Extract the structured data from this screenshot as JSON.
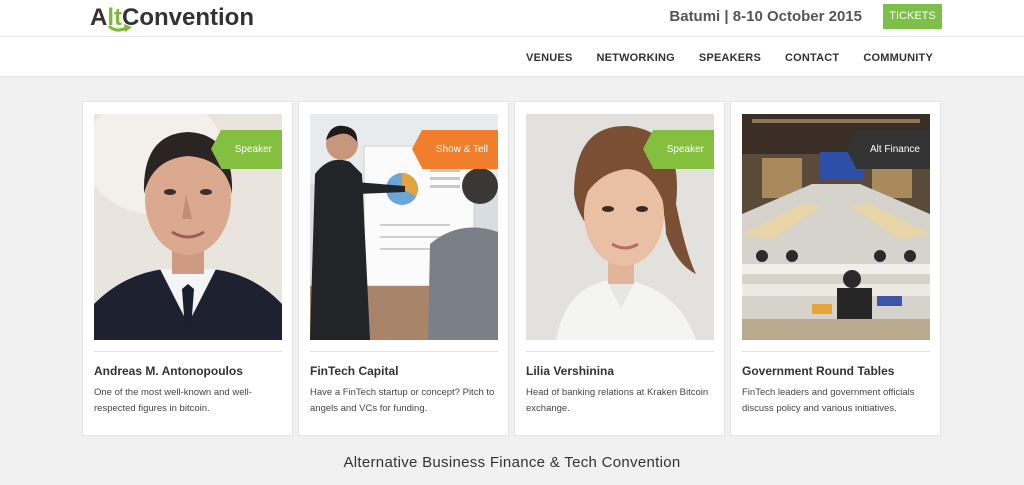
{
  "header": {
    "logo_a": "A",
    "logo_lt": "lt",
    "logo_rest": "Convention",
    "event_info": "Batumi | 8-10 October 2015",
    "tickets_label": "TICKETS"
  },
  "nav": {
    "items": [
      "VENUES",
      "NETWORKING",
      "SPEAKERS",
      "CONTACT",
      "COMMUNITY"
    ]
  },
  "cards": [
    {
      "tag": "Speaker",
      "tag_color": "#84bf3f",
      "title": "Andreas M. Antonopoulos",
      "description": "One of the most well-known and well-respected figures in bitcoin."
    },
    {
      "tag": "Show & Tell",
      "tag_color": "#f07e2c",
      "title": "FinTech Capital",
      "description": "Have a FinTech startup or concept? Pitch to angels and VCs for funding."
    },
    {
      "tag": "Speaker",
      "tag_color": "#84bf3f",
      "title": "Lilia Vershinina",
      "description": "Head of banking relations at Kraken Bitcoin exchange."
    },
    {
      "tag": "Alt Finance",
      "tag_color": "#333333",
      "title": "Government Round Tables",
      "description": "FinTech leaders and government officials discuss policy and various initiatives."
    }
  ],
  "footer": {
    "title": "Alternative Business Finance & Tech Convention"
  },
  "colors": {
    "accent_green": "#7cc04a",
    "accent_orange": "#f07e2c",
    "dark": "#333333"
  }
}
